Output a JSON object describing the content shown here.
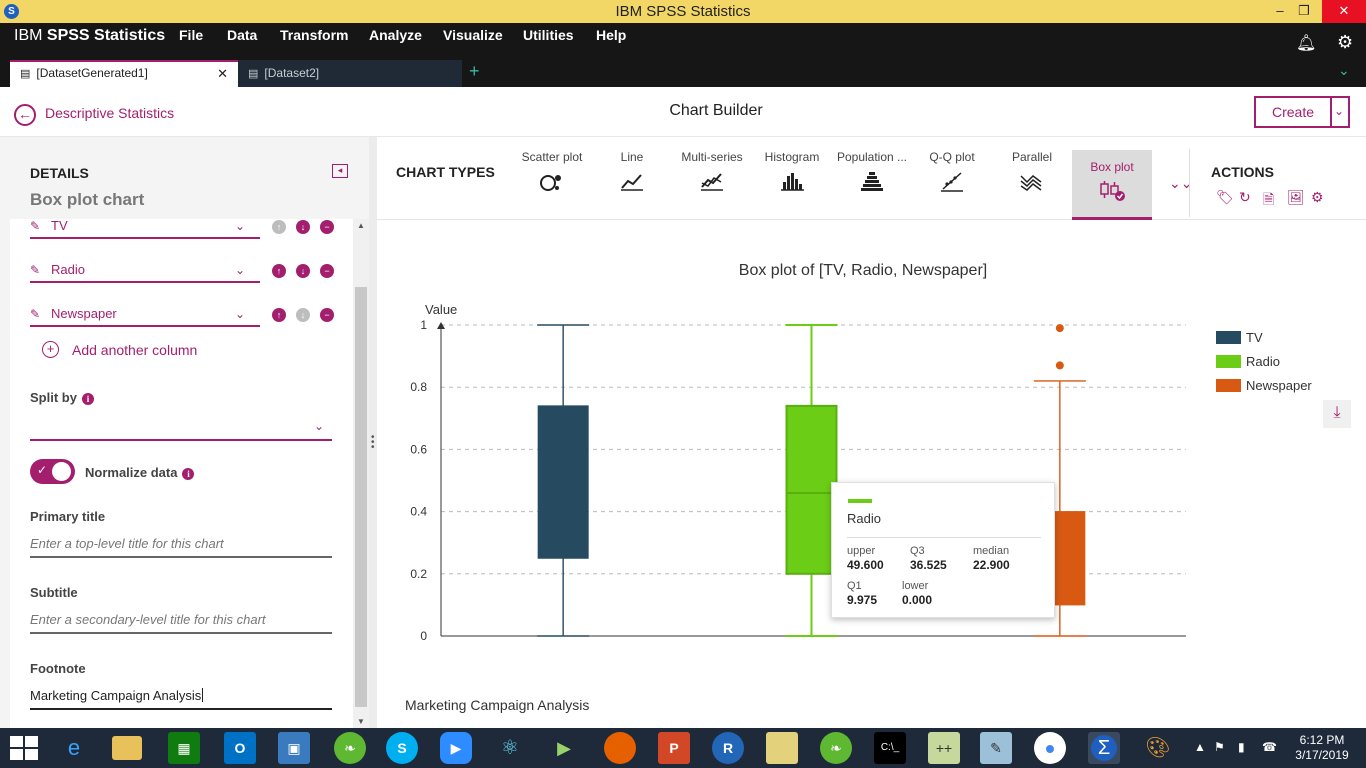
{
  "window": {
    "title": "IBM SPSS Statistics",
    "minimize": "–",
    "maximize": "❐",
    "close": "✕"
  },
  "menubar": {
    "brand_light": "IBM ",
    "brand_bold": "SPSS Statistics",
    "items": [
      "File",
      "Data",
      "Transform",
      "Analyze",
      "Visualize",
      "Utilities",
      "Help"
    ]
  },
  "dataset_tabs": [
    {
      "label": "[DatasetGenerated1]",
      "active": true,
      "close": "✕"
    },
    {
      "label": "[Dataset2]",
      "active": false
    }
  ],
  "tab_add": "+",
  "header": {
    "back_label": "Descriptive Statistics",
    "title": "Chart Builder",
    "create_label": "Create"
  },
  "details": {
    "heading": "DETAILS",
    "subheading": "Box plot chart",
    "columns": [
      "TV",
      "Radio",
      "Newspaper"
    ],
    "add_column": "Add another column",
    "split_by_label": "Split by",
    "normalize_label": "Normalize data",
    "normalize_on": true,
    "primary_title_label": "Primary title",
    "primary_title_placeholder": "Enter a top-level title for this chart",
    "subtitle_label": "Subtitle",
    "subtitle_placeholder": "Enter a secondary-level title for this chart",
    "footnote_label": "Footnote",
    "footnote_value": "Marketing Campaign Analysis"
  },
  "chart_types": {
    "heading": "CHART TYPES",
    "items": [
      {
        "label": "Scatter plot",
        "icon": "scatter-plot-icon"
      },
      {
        "label": "Line",
        "icon": "line-chart-icon"
      },
      {
        "label": "Multi-series",
        "icon": "multi-series-icon"
      },
      {
        "label": "Histogram",
        "icon": "histogram-icon"
      },
      {
        "label": "Population ...",
        "icon": "population-pyramid-icon"
      },
      {
        "label": "Q-Q plot",
        "icon": "qq-plot-icon"
      },
      {
        "label": "Parallel",
        "icon": "parallel-icon"
      },
      {
        "label": "Box plot",
        "icon": "box-plot-icon",
        "selected": true
      }
    ]
  },
  "actions": {
    "heading": "ACTIONS",
    "icons": [
      "tag-icon",
      "refresh-icon",
      "code-file-icon",
      "image-file-icon",
      "settings-icon"
    ]
  },
  "chart_data": {
    "type": "box",
    "title": "Box plot of [TV, Radio, Newspaper]",
    "ylabel": "Value",
    "ylim": [
      0,
      1
    ],
    "yticks": [
      "0",
      "0.2",
      "0.4",
      "0.6",
      "0.8",
      "1"
    ],
    "footnote": "Marketing Campaign Analysis",
    "legend_position": "right",
    "grid": true,
    "series": [
      {
        "name": "TV",
        "color": "#264a60",
        "min": 0.0,
        "q1": 0.25,
        "median": 0.5,
        "q3": 0.74,
        "max": 1.0,
        "outliers": []
      },
      {
        "name": "Radio",
        "color": "#6ccd17",
        "min": 0.0,
        "q1": 0.2,
        "median": 0.46,
        "q3": 0.74,
        "max": 1.0,
        "outliers": [],
        "highlighted": true
      },
      {
        "name": "Newspaper",
        "color": "#d85a12",
        "min": 0.0,
        "q1": 0.1,
        "median": 0.25,
        "q3": 0.4,
        "max": 0.82,
        "outliers": [
          0.87,
          0.99
        ]
      }
    ]
  },
  "tooltip": {
    "series": "Radio",
    "stats": [
      {
        "key": "upper",
        "value": "49.600"
      },
      {
        "key": "Q3",
        "value": "36.525"
      },
      {
        "key": "median",
        "value": "22.900"
      },
      {
        "key": "Q1",
        "value": "9.975"
      },
      {
        "key": "lower",
        "value": "0.000"
      }
    ]
  },
  "taskbar": {
    "time": "6:12 PM",
    "date": "3/17/2019"
  }
}
